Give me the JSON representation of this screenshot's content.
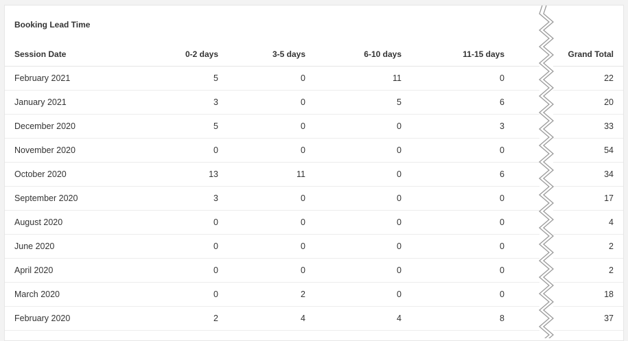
{
  "chart_data": {
    "type": "table",
    "title": "Booking Lead Time",
    "columns": [
      "Session Date",
      "0-2 days",
      "3-5 days",
      "6-10 days",
      "11-15 days",
      "Grand Total"
    ],
    "rows": [
      {
        "label": "February 2021",
        "values": [
          "5",
          "0",
          "11",
          "0",
          "22"
        ]
      },
      {
        "label": "January 2021",
        "values": [
          "3",
          "0",
          "5",
          "6",
          "20"
        ]
      },
      {
        "label": "December 2020",
        "values": [
          "5",
          "0",
          "0",
          "3",
          "33"
        ]
      },
      {
        "label": "November 2020",
        "values": [
          "0",
          "0",
          "0",
          "0",
          "54"
        ]
      },
      {
        "label": "October 2020",
        "values": [
          "13",
          "11",
          "0",
          "6",
          "34"
        ]
      },
      {
        "label": "September 2020",
        "values": [
          "3",
          "0",
          "0",
          "0",
          "17"
        ]
      },
      {
        "label": "August 2020",
        "values": [
          "0",
          "0",
          "0",
          "0",
          "4"
        ]
      },
      {
        "label": "June 2020",
        "values": [
          "0",
          "0",
          "0",
          "0",
          "2"
        ]
      },
      {
        "label": "April 2020",
        "values": [
          "0",
          "0",
          "0",
          "0",
          "2"
        ]
      },
      {
        "label": "March 2020",
        "values": [
          "0",
          "2",
          "0",
          "0",
          "18"
        ]
      },
      {
        "label": "February 2020",
        "values": [
          "2",
          "4",
          "4",
          "8",
          "37"
        ]
      }
    ]
  }
}
